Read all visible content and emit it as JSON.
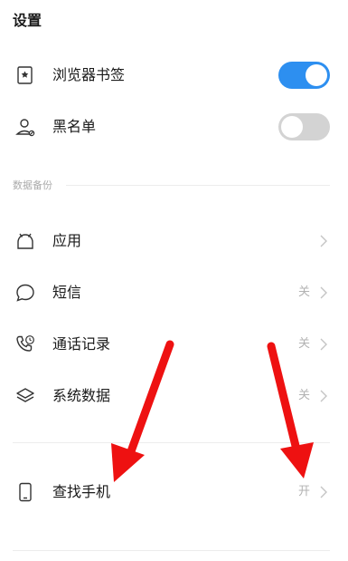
{
  "header": {
    "title": "设置"
  },
  "toggles": [
    {
      "label": "浏览器书签",
      "icon": "bookmark-icon",
      "state": "on"
    },
    {
      "label": "黑名单",
      "icon": "user-block-icon",
      "state": "off"
    }
  ],
  "section": {
    "title": "数据备份"
  },
  "backup_items": [
    {
      "label": "应用",
      "icon": "android-icon",
      "value": ""
    },
    {
      "label": "短信",
      "icon": "message-bubble-icon",
      "value": "关"
    },
    {
      "label": "通话记录",
      "icon": "phone-clock-icon",
      "value": "关"
    },
    {
      "label": "系统数据",
      "icon": "layers-icon",
      "value": "关"
    }
  ],
  "find_phone": {
    "label": "查找手机",
    "icon": "phone-device-icon",
    "value": "开"
  },
  "colors": {
    "accent": "#2d8ff0",
    "toggle_off": "#d3d3d3",
    "arrow": "#ee1111",
    "muted": "#b2b2b2"
  }
}
